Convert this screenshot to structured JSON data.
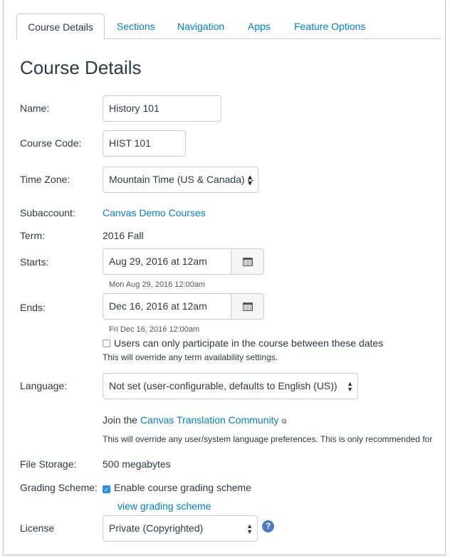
{
  "tabs": [
    {
      "label": "Course Details",
      "active": true
    },
    {
      "label": "Sections"
    },
    {
      "label": "Navigation"
    },
    {
      "label": "Apps"
    },
    {
      "label": "Feature Options"
    }
  ],
  "title": "Course Details",
  "fields": {
    "name": {
      "label": "Name:",
      "value": "History 101"
    },
    "code": {
      "label": "Course Code:",
      "value": "HIST 101"
    },
    "timezone": {
      "label": "Time Zone:",
      "value": "Mountain Time (US & Canada) (-"
    },
    "subaccount": {
      "label": "Subaccount:",
      "value": "Canvas Demo Courses"
    },
    "term": {
      "label": "Term:",
      "value": "2016 Fall"
    },
    "starts": {
      "label": "Starts:",
      "value": "Aug 29, 2016 at 12am",
      "hint": "Mon Aug 29, 2016 12:00am"
    },
    "ends": {
      "label": "Ends:",
      "value": "Dec 16, 2016 at 12am",
      "hint": "Fri Dec 16, 2016 12:00am"
    },
    "restrict": {
      "label": "Users can only participate in the course between these dates",
      "checked": false,
      "note": "This will override any term availability settings."
    },
    "language": {
      "label": "Language:",
      "value": "Not set (user-configurable, defaults to English (US))",
      "join_prefix": "Join the",
      "join_link": "Canvas Translation Community",
      "note": "This will override any user/system language preferences. This is only recommended for"
    },
    "storage": {
      "label": "File Storage:",
      "value": "500 megabytes"
    },
    "grading": {
      "label": "Grading Scheme:",
      "checkbox_label": "Enable course grading scheme",
      "checked": true,
      "link": "view grading scheme"
    },
    "license": {
      "label": "License",
      "value": "Private (Copyrighted)"
    }
  },
  "colors": {
    "link": "#0081d4",
    "text": "#2d3b45",
    "border": "#c7cdd1"
  }
}
